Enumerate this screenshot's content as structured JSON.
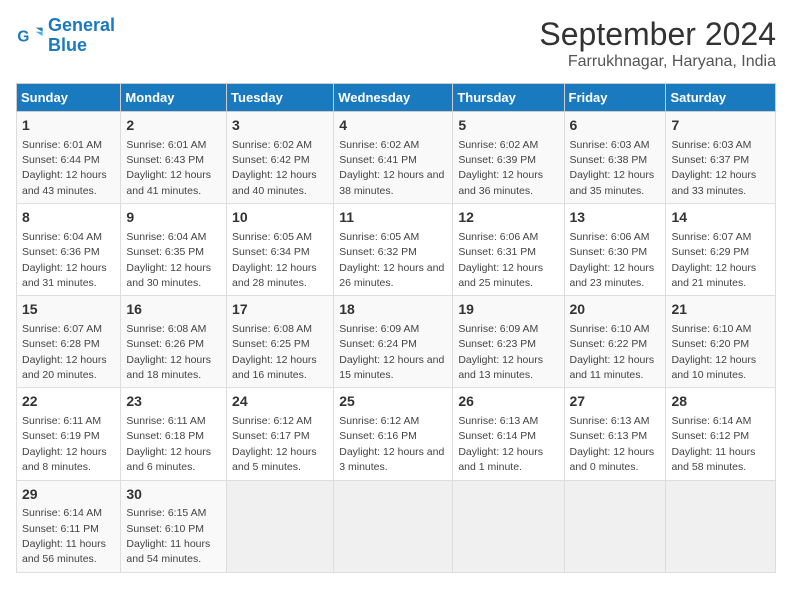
{
  "header": {
    "logo_line1": "General",
    "logo_line2": "Blue",
    "title": "September 2024",
    "subtitle": "Farrukhnagar, Haryana, India"
  },
  "days_of_week": [
    "Sunday",
    "Monday",
    "Tuesday",
    "Wednesday",
    "Thursday",
    "Friday",
    "Saturday"
  ],
  "weeks": [
    [
      {
        "day": 1,
        "sunrise": "6:01 AM",
        "sunset": "6:44 PM",
        "daylight": "12 hours and 43 minutes."
      },
      {
        "day": 2,
        "sunrise": "6:01 AM",
        "sunset": "6:43 PM",
        "daylight": "12 hours and 41 minutes."
      },
      {
        "day": 3,
        "sunrise": "6:02 AM",
        "sunset": "6:42 PM",
        "daylight": "12 hours and 40 minutes."
      },
      {
        "day": 4,
        "sunrise": "6:02 AM",
        "sunset": "6:41 PM",
        "daylight": "12 hours and 38 minutes."
      },
      {
        "day": 5,
        "sunrise": "6:02 AM",
        "sunset": "6:39 PM",
        "daylight": "12 hours and 36 minutes."
      },
      {
        "day": 6,
        "sunrise": "6:03 AM",
        "sunset": "6:38 PM",
        "daylight": "12 hours and 35 minutes."
      },
      {
        "day": 7,
        "sunrise": "6:03 AM",
        "sunset": "6:37 PM",
        "daylight": "12 hours and 33 minutes."
      }
    ],
    [
      {
        "day": 8,
        "sunrise": "6:04 AM",
        "sunset": "6:36 PM",
        "daylight": "12 hours and 31 minutes."
      },
      {
        "day": 9,
        "sunrise": "6:04 AM",
        "sunset": "6:35 PM",
        "daylight": "12 hours and 30 minutes."
      },
      {
        "day": 10,
        "sunrise": "6:05 AM",
        "sunset": "6:34 PM",
        "daylight": "12 hours and 28 minutes."
      },
      {
        "day": 11,
        "sunrise": "6:05 AM",
        "sunset": "6:32 PM",
        "daylight": "12 hours and 26 minutes."
      },
      {
        "day": 12,
        "sunrise": "6:06 AM",
        "sunset": "6:31 PM",
        "daylight": "12 hours and 25 minutes."
      },
      {
        "day": 13,
        "sunrise": "6:06 AM",
        "sunset": "6:30 PM",
        "daylight": "12 hours and 23 minutes."
      },
      {
        "day": 14,
        "sunrise": "6:07 AM",
        "sunset": "6:29 PM",
        "daylight": "12 hours and 21 minutes."
      }
    ],
    [
      {
        "day": 15,
        "sunrise": "6:07 AM",
        "sunset": "6:28 PM",
        "daylight": "12 hours and 20 minutes."
      },
      {
        "day": 16,
        "sunrise": "6:08 AM",
        "sunset": "6:26 PM",
        "daylight": "12 hours and 18 minutes."
      },
      {
        "day": 17,
        "sunrise": "6:08 AM",
        "sunset": "6:25 PM",
        "daylight": "12 hours and 16 minutes."
      },
      {
        "day": 18,
        "sunrise": "6:09 AM",
        "sunset": "6:24 PM",
        "daylight": "12 hours and 15 minutes."
      },
      {
        "day": 19,
        "sunrise": "6:09 AM",
        "sunset": "6:23 PM",
        "daylight": "12 hours and 13 minutes."
      },
      {
        "day": 20,
        "sunrise": "6:10 AM",
        "sunset": "6:22 PM",
        "daylight": "12 hours and 11 minutes."
      },
      {
        "day": 21,
        "sunrise": "6:10 AM",
        "sunset": "6:20 PM",
        "daylight": "12 hours and 10 minutes."
      }
    ],
    [
      {
        "day": 22,
        "sunrise": "6:11 AM",
        "sunset": "6:19 PM",
        "daylight": "12 hours and 8 minutes."
      },
      {
        "day": 23,
        "sunrise": "6:11 AM",
        "sunset": "6:18 PM",
        "daylight": "12 hours and 6 minutes."
      },
      {
        "day": 24,
        "sunrise": "6:12 AM",
        "sunset": "6:17 PM",
        "daylight": "12 hours and 5 minutes."
      },
      {
        "day": 25,
        "sunrise": "6:12 AM",
        "sunset": "6:16 PM",
        "daylight": "12 hours and 3 minutes."
      },
      {
        "day": 26,
        "sunrise": "6:13 AM",
        "sunset": "6:14 PM",
        "daylight": "12 hours and 1 minute."
      },
      {
        "day": 27,
        "sunrise": "6:13 AM",
        "sunset": "6:13 PM",
        "daylight": "12 hours and 0 minutes."
      },
      {
        "day": 28,
        "sunrise": "6:14 AM",
        "sunset": "6:12 PM",
        "daylight": "11 hours and 58 minutes."
      }
    ],
    [
      {
        "day": 29,
        "sunrise": "6:14 AM",
        "sunset": "6:11 PM",
        "daylight": "11 hours and 56 minutes."
      },
      {
        "day": 30,
        "sunrise": "6:15 AM",
        "sunset": "6:10 PM",
        "daylight": "11 hours and 54 minutes."
      },
      null,
      null,
      null,
      null,
      null
    ]
  ]
}
